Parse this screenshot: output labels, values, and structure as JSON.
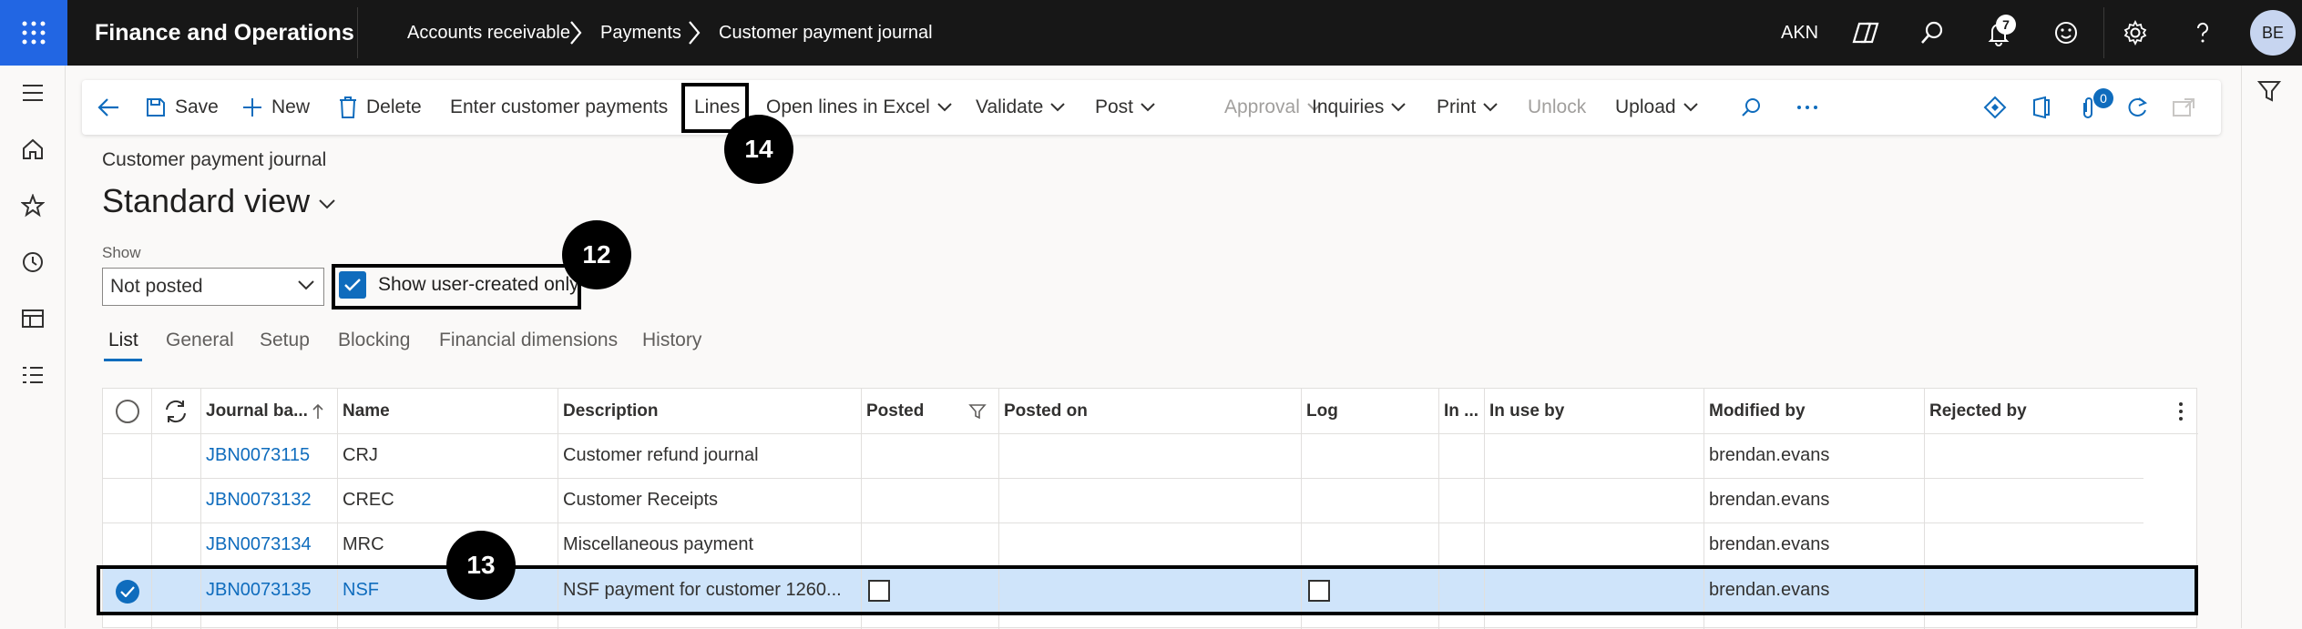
{
  "app": {
    "title": "Finance and Operations",
    "company": "AKN",
    "avatar_initials": "BE",
    "notification_count": "7"
  },
  "breadcrumb": [
    "Accounts receivable",
    "Payments",
    "Customer payment journal"
  ],
  "toolbar": {
    "save": "Save",
    "new": "New",
    "delete": "Delete",
    "enter_payments": "Enter customer payments",
    "lines": "Lines",
    "open_lines_excel": "Open lines in Excel",
    "validate": "Validate",
    "post": "Post",
    "approval": "Approval",
    "inquiries": "Inquiries",
    "print": "Print",
    "unlock": "Unlock",
    "upload": "Upload",
    "attachments_count": "0"
  },
  "page": {
    "caption": "Customer payment journal",
    "view": "Standard view"
  },
  "filter": {
    "show_label": "Show",
    "show_value": "Not posted",
    "user_created_label": "Show user-created only",
    "user_created_checked": true
  },
  "tabs": [
    "List",
    "General",
    "Setup",
    "Blocking",
    "Financial dimensions",
    "History"
  ],
  "grid": {
    "columns": [
      "Journal ba...",
      "Name",
      "Description",
      "Posted",
      "Posted on",
      "Log",
      "In ...",
      "In use by",
      "Modified by",
      "Rejected by"
    ],
    "rows": [
      {
        "journal": "JBN0073115",
        "name": "CRJ",
        "description": "Customer refund journal",
        "modified_by": "brendan.evans"
      },
      {
        "journal": "JBN0073132",
        "name": "CREC",
        "description": "Customer Receipts",
        "modified_by": "brendan.evans"
      },
      {
        "journal": "JBN0073134",
        "name": "MRC",
        "description": "Miscellaneous payment",
        "modified_by": "brendan.evans"
      },
      {
        "journal": "JBN0073135",
        "name": "NSF",
        "description": "NSF payment for customer 1260...",
        "modified_by": "brendan.evans",
        "selected": true
      }
    ]
  },
  "callouts": {
    "c12": "12",
    "c13": "13",
    "c14": "14"
  },
  "colors": {
    "accent": "#0f6cbd",
    "topbar": "#171717",
    "waffle": "#2266e3",
    "selected_row": "#cfe4fa"
  }
}
